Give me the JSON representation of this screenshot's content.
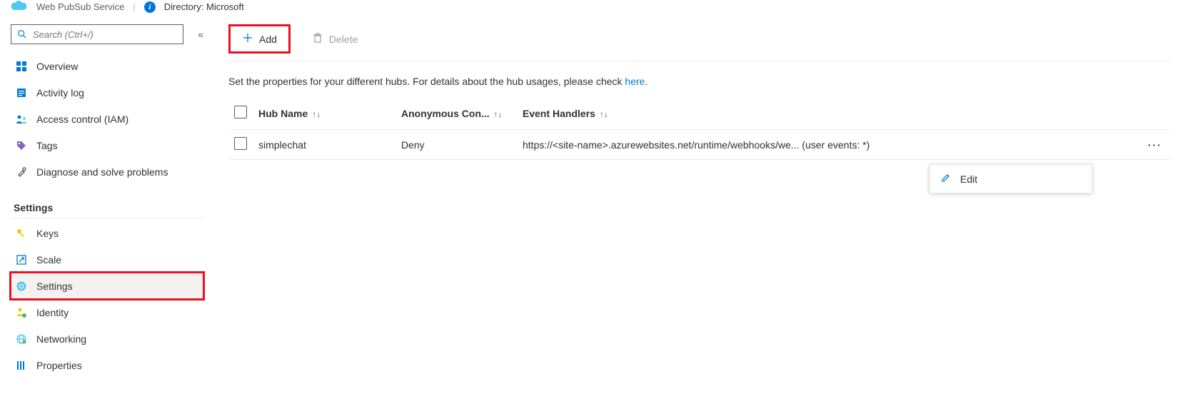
{
  "top": {
    "service_type": "Web PubSub Service",
    "directory_label": "Directory:",
    "directory_value": "Microsoft"
  },
  "sidebar": {
    "search_placeholder": "Search (Ctrl+/)",
    "items_top": [
      {
        "label": "Overview"
      },
      {
        "label": "Activity log"
      },
      {
        "label": "Access control (IAM)"
      },
      {
        "label": "Tags"
      },
      {
        "label": "Diagnose and solve problems"
      }
    ],
    "settings_header": "Settings",
    "items_settings": [
      {
        "label": "Keys"
      },
      {
        "label": "Scale"
      },
      {
        "label": "Settings"
      },
      {
        "label": "Identity"
      },
      {
        "label": "Networking"
      },
      {
        "label": "Properties"
      }
    ]
  },
  "toolbar": {
    "add_label": "Add",
    "delete_label": "Delete"
  },
  "main": {
    "intro_text": "Set the properties for your different hubs. For details about the hub usages, please check ",
    "intro_link": "here",
    "intro_period": ".",
    "columns": {
      "hub": "Hub Name",
      "anon": "Anonymous Con...",
      "handlers": "Event Handlers"
    },
    "rows": [
      {
        "hub": "simplechat",
        "anon": "Deny",
        "handlers": "https://<site-name>.azurewebsites.net/runtime/webhooks/we... (user events: *)"
      }
    ]
  },
  "context": {
    "edit_label": "Edit"
  }
}
